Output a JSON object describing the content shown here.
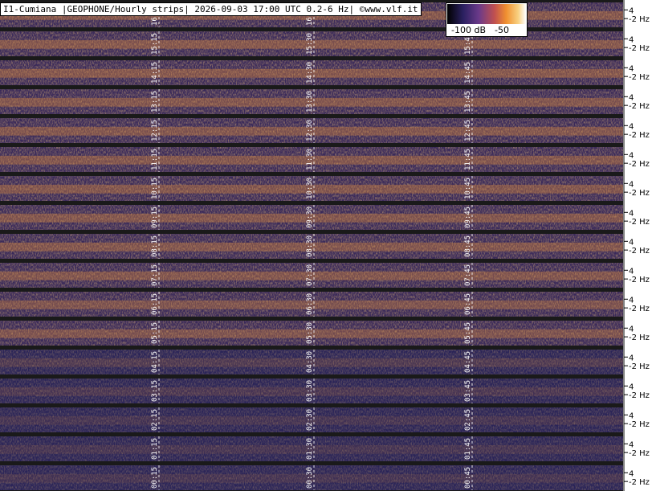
{
  "title": "I1-Cumiana |GEOPHONE/Hourly strips| 2026-09-03 17:00 UTC 0.2-6 Hz| ©www.vlf.it",
  "colorscale": {
    "min_label": "-100 dB",
    "max_label": "-50",
    "colors": [
      "#000000",
      "#2a2060",
      "#5a3a8a",
      "#a05070",
      "#e08030",
      "#f8c060",
      "#ffffff"
    ]
  },
  "palette": {
    "background": "#2b2350",
    "separator": "#1a1a1a",
    "axis": "#ffffff",
    "marker": "#ffffff"
  },
  "chart_data": {
    "type": "heatmap",
    "y_axis_labels": [
      "4",
      "2 Hz"
    ],
    "strips": [
      {
        "marks": [
          "16:15",
          "16:30",
          "16:45"
        ],
        "intensity": 0.85
      },
      {
        "marks": [
          "15:15",
          "15:30",
          "15:45"
        ],
        "intensity": 0.85
      },
      {
        "marks": [
          "14:15",
          "14:30",
          "14:45"
        ],
        "intensity": 0.85
      },
      {
        "marks": [
          "13:15",
          "13:30",
          "13:45"
        ],
        "intensity": 0.8
      },
      {
        "marks": [
          "12:15",
          "12:30",
          "12:45"
        ],
        "intensity": 0.8
      },
      {
        "marks": [
          "11:15",
          "11:30",
          "11:45"
        ],
        "intensity": 0.8
      },
      {
        "marks": [
          "10:15",
          "10:30",
          "10:45"
        ],
        "intensity": 0.8
      },
      {
        "marks": [
          "09:15",
          "09:30",
          "09:45"
        ],
        "intensity": 0.8
      },
      {
        "marks": [
          "08:15",
          "08:30",
          "08:45"
        ],
        "intensity": 0.8
      },
      {
        "marks": [
          "07:15",
          "07:30",
          "07:45"
        ],
        "intensity": 0.8
      },
      {
        "marks": [
          "06:15",
          "06:30",
          "06:45"
        ],
        "intensity": 0.75
      },
      {
        "marks": [
          "05:15",
          "05:30",
          "05:45"
        ],
        "intensity": 0.75
      },
      {
        "marks": [
          "04:15",
          "04:30",
          "04:45"
        ],
        "intensity": 0.35
      },
      {
        "marks": [
          "03:15",
          "03:30",
          "03:45"
        ],
        "intensity": 0.3
      },
      {
        "marks": [
          "02:15",
          "02:30",
          "02:45"
        ],
        "intensity": 0.25
      },
      {
        "marks": [
          "01:15",
          "01:30",
          "01:45"
        ],
        "intensity": 0.25
      },
      {
        "marks": [
          "00:15",
          "00:30",
          "00:45"
        ],
        "intensity": 0.25
      }
    ]
  }
}
